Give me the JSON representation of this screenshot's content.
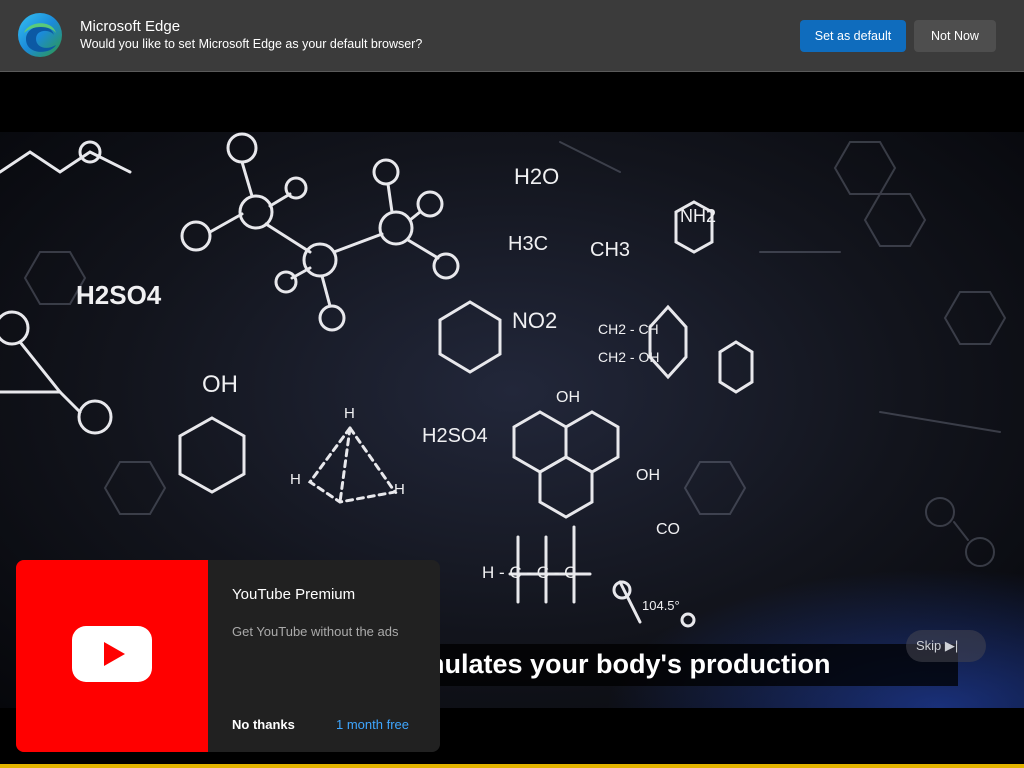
{
  "edge_prompt": {
    "title": "Microsoft Edge",
    "message": "Would you like to set Microsoft Edge as your default browser?",
    "primary_button": "Set as default",
    "secondary_button": "Not Now",
    "logo_icon": "edge-logo-icon"
  },
  "video": {
    "subtitle": "nulates your body's production",
    "skip_label": "Skip ▶|",
    "chem_labels": [
      "H2O",
      "H2SO4",
      "H3C",
      "CH3",
      "NH2",
      "NO2",
      "OH",
      "H2SO4",
      "OH",
      "OH",
      "H",
      "H",
      "H",
      "CH2 - CH",
      "CH2 - OH",
      "H - C - C - C",
      "CO",
      "104.5°"
    ]
  },
  "premium_card": {
    "title": "YouTube Premium",
    "description": "Get YouTube without the ads",
    "dismiss_label": "No thanks",
    "offer_label": "1 month free",
    "logo_icon": "youtube-play-icon",
    "colors": {
      "art": "#ff0000",
      "offer": "#3ea6ff"
    }
  }
}
